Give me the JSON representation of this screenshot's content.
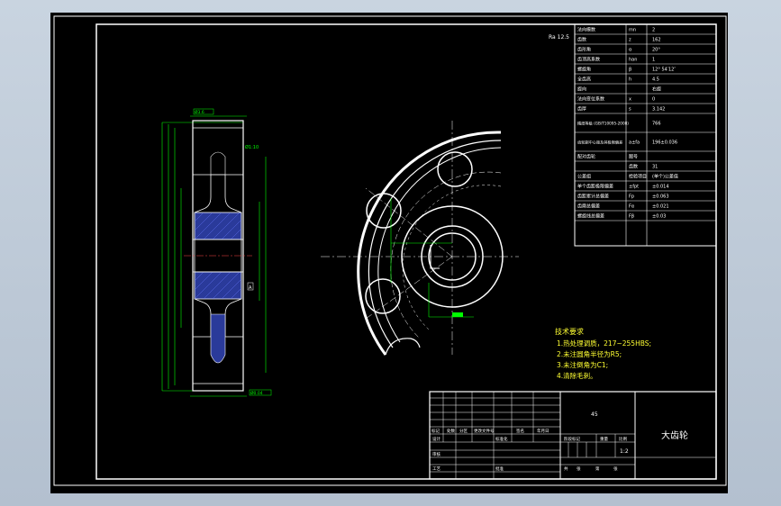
{
  "colors": {
    "background": "#000000",
    "frame": "#ffffff",
    "dimension": "#00ff00",
    "notes": "#ffff33",
    "hatch": "#3344cc",
    "centerline": "#ff4444"
  },
  "roughness_mark": "Ra 12.5",
  "params_table": {
    "rows": [
      {
        "name": "法向模数",
        "symbol": "mn",
        "value": "2"
      },
      {
        "name": "齿数",
        "symbol": "z",
        "value": "162"
      },
      {
        "name": "齿形角",
        "symbol": "α",
        "value": "20°"
      },
      {
        "name": "齿顶高系数",
        "symbol": "han",
        "value": "1"
      },
      {
        "name": "螺旋角",
        "symbol": "β",
        "value": "12° 54′12″"
      },
      {
        "name": "全齿高",
        "symbol": "h",
        "value": "4.5"
      },
      {
        "name": "旋向",
        "symbol": "",
        "value": "右旋"
      },
      {
        "name": "法向变位系数",
        "symbol": "x",
        "value": "0"
      },
      {
        "name": "齿厚",
        "symbol": "s",
        "value": "3.142"
      },
      {
        "name": "精度等级 (GB/T10095-2008)",
        "symbol": "",
        "value": "766"
      },
      {
        "name": "齿轮副中心距及其极限偏差",
        "symbol": "a±fa",
        "value": "196±0.036"
      },
      {
        "name": "配对齿轮",
        "symbol": "图号",
        "value": ""
      },
      {
        "name": "",
        "symbol": "齿数",
        "value": "31"
      },
      {
        "name": "公差组",
        "symbol": "检验项目",
        "value": "(单个)公差值"
      },
      {
        "name": "单个齿距极限偏差",
        "symbol": "±fpt",
        "value": "±0.014"
      },
      {
        "name": "齿距累计总偏差",
        "symbol": "Fp",
        "value": "±0.063"
      },
      {
        "name": "齿廓总偏差",
        "symbol": "Fα",
        "value": "±0.021"
      },
      {
        "name": "螺旋线总偏差",
        "symbol": "Fβ",
        "value": "±0.03"
      }
    ]
  },
  "tech_requirements": {
    "title": "技术要求",
    "items": [
      "1.热处理调质，217~255HBS;",
      "2.未注圆角半径为R5;",
      "3.未注倒角为C1;",
      "4.清除毛刺。"
    ]
  },
  "title_block": {
    "part_name": "大齿轮",
    "material": "45",
    "scale": "1:2",
    "headers": [
      "标记",
      "处数",
      "分区",
      "更改文件号",
      "签名",
      "年月日"
    ],
    "rows": [
      "设计",
      "标准化",
      "审核",
      "工艺",
      "批准"
    ],
    "labels": [
      "阶段标记",
      "重量",
      "比例",
      "共",
      "张",
      "第",
      "张"
    ]
  },
  "section_labels": {
    "top_dim": "Ø3.6",
    "bottom_dim": "Ø0.04",
    "right_tag": "Ø1:10",
    "small_tag": "A"
  }
}
